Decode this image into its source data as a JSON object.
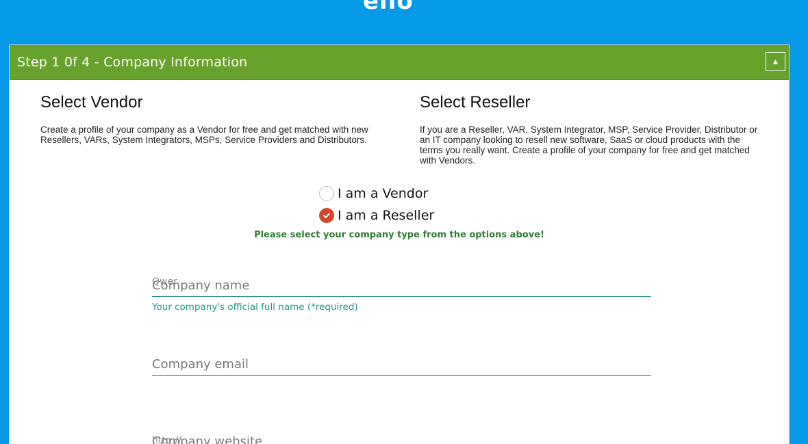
{
  "header": {
    "logo_text": "ello"
  },
  "panel": {
    "title": "Step 1 0f 4 - Company Information",
    "collapse_icon": "triangle-up-icon"
  },
  "vendor": {
    "heading": "Select Vendor",
    "description": "Create a profile of your company as a Vendor for free and get matched with new Resellers, VARs, System Integrators, MSPs, Service Providers and Distributors."
  },
  "reseller": {
    "heading": "Select Reseller",
    "description": "If you are a Reseller, VAR, System Integrator, MSP, Service Provider, Distributor or an IT company looking to resell new software, SaaS or cloud products with the terms you really want. Create a profile of your company for free and get matched with Vendors."
  },
  "company_type": {
    "options": [
      {
        "label": "I am a Vendor",
        "checked": false
      },
      {
        "label": "I am a Reseller",
        "checked": true
      }
    ],
    "hint": "Please select your company type from the options above!"
  },
  "fields": {
    "company_name": {
      "value": "Qwer",
      "placeholder": "Company name",
      "help": "Your company's official full name (*required)"
    },
    "company_email": {
      "placeholder": "Company email"
    },
    "company_website": {
      "value": "http://",
      "placeholder": "Company website"
    }
  },
  "colors": {
    "background": "#0599e6",
    "header_green": "#67a22c",
    "checked_radio": "#d2472a",
    "hint_green": "#2e7d32",
    "field_teal": "#1c9a8c"
  }
}
